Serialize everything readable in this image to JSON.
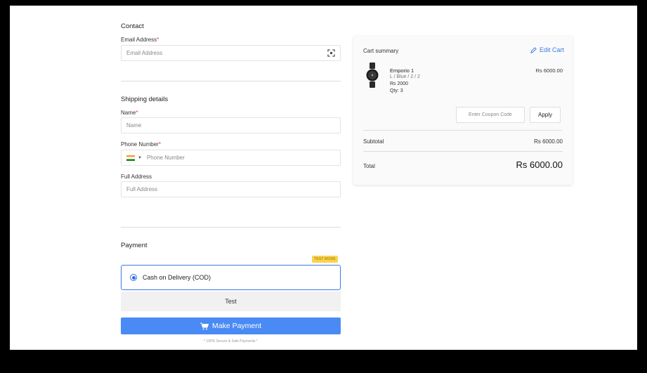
{
  "contact": {
    "title": "Contact",
    "email_label": "Email Address",
    "email_placeholder": "Email Address"
  },
  "shipping": {
    "title": "Shipping details",
    "name_label": "Name",
    "name_placeholder": "Name",
    "phone_label": "Phone Number",
    "phone_placeholder": "Phone Number",
    "address_label": "Full Address",
    "address_placeholder": "Full Address"
  },
  "payment": {
    "title": "Payment",
    "badge": "TEST MODE",
    "option": "Cash on Delivery (COD)",
    "test_label": "Test",
    "button_label": "Make Payment",
    "secure_note": "* 100% Secure & Safe Payments *"
  },
  "cart": {
    "title": "Cart summary",
    "edit_label": "Edit Cart",
    "item": {
      "name": "Emporio 1",
      "variant": "L / Blue / 2 / 2",
      "unit_price": "Rs 2000",
      "qty": "Qty: 3",
      "line_total": "Rs 6000.00"
    },
    "coupon_placeholder": "Enter Coupon Code",
    "apply_label": "Apply",
    "subtotal_label": "Subtotal",
    "subtotal_value": "Rs 6000.00",
    "total_label": "Total",
    "total_value": "Rs 6000.00"
  },
  "colors": {
    "accent": "#4a8af4",
    "link": "#3b7ae6",
    "badge": "#fcd34d",
    "required": "#e53935"
  }
}
